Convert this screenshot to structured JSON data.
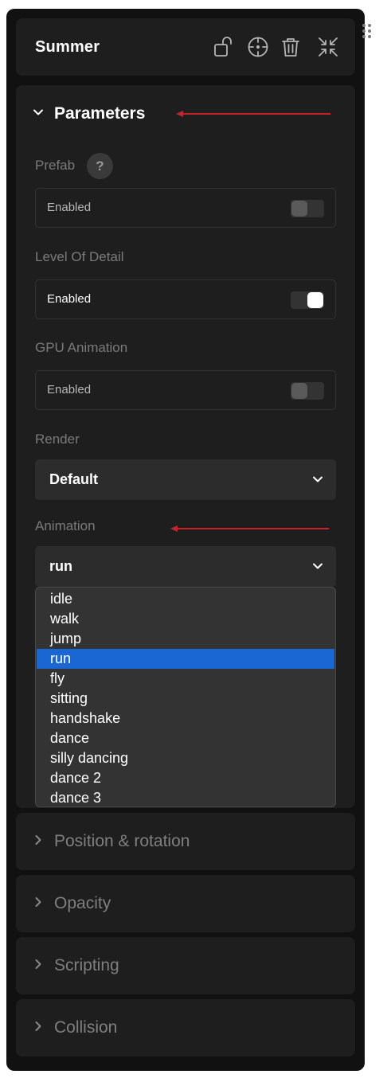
{
  "header": {
    "title": "Summer",
    "icons": [
      "unlock-icon",
      "target-icon",
      "trash-icon",
      "collapse-icon"
    ]
  },
  "parameters": {
    "title": "Parameters",
    "prefab": {
      "label": "Prefab",
      "help": "?",
      "toggle_label": "Enabled",
      "enabled": false
    },
    "lod": {
      "label": "Level Of Detail",
      "toggle_label": "Enabled",
      "enabled": true
    },
    "gpu": {
      "label": "GPU Animation",
      "toggle_label": "Enabled",
      "enabled": false
    },
    "render": {
      "label": "Render",
      "value": "Default"
    },
    "animation": {
      "label": "Animation",
      "value": "run",
      "options": [
        "idle",
        "walk",
        "jump",
        "run",
        "fly",
        "sitting",
        "handshake",
        "dance",
        "silly dancing",
        "dance 2",
        "dance 3"
      ],
      "selected_index": 3
    }
  },
  "sections": [
    {
      "title": "Position & rotation"
    },
    {
      "title": "Opacity"
    },
    {
      "title": "Scripting"
    },
    {
      "title": "Collision"
    }
  ],
  "colors": {
    "accent": "#1a67d4",
    "annotation_arrow": "#c8232c",
    "panel_bg": "#111111",
    "card_bg": "#1e1e1e"
  }
}
